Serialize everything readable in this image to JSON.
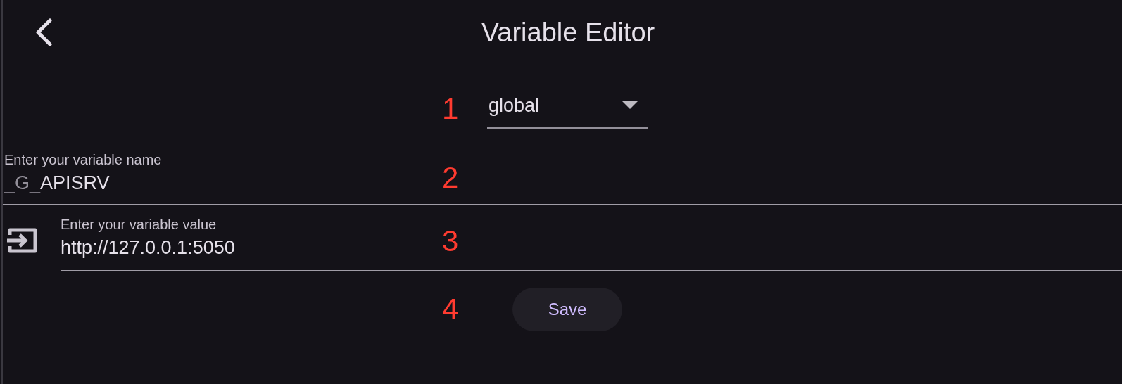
{
  "header": {
    "title": "Variable Editor"
  },
  "scope_dropdown": {
    "value": "global"
  },
  "name_field": {
    "label": "Enter your variable name",
    "prefix": "_G_",
    "value": "APISRV"
  },
  "value_field": {
    "label": "Enter your variable value",
    "value": "http://127.0.0.1:5050"
  },
  "save_button": {
    "label": "Save"
  },
  "annotations": [
    {
      "label": "1"
    },
    {
      "label": "2"
    },
    {
      "label": "3"
    },
    {
      "label": "4"
    }
  ]
}
